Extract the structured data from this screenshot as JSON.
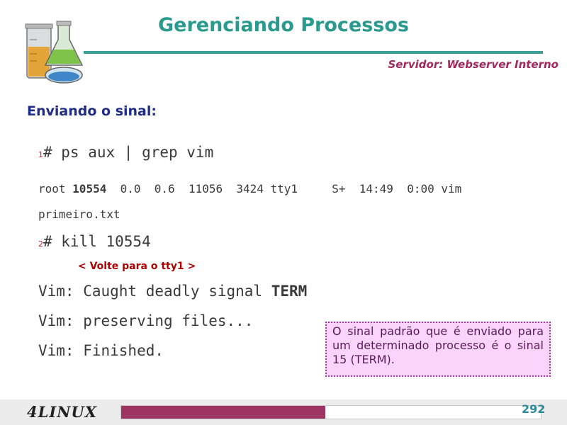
{
  "header": {
    "title": "Gerenciando Processos",
    "subtitle": "Servidor: Webserver Interno"
  },
  "section_title": "Enviando o sinal:",
  "steps": [
    {
      "number": "1",
      "command": "# ps aux | grep vim"
    },
    {
      "number": "2",
      "command": "# kill 10554"
    }
  ],
  "ps_output": {
    "prefix": "root ",
    "pid": "10554",
    "rest": "  0.0  0.6  11056  3424 tty1     S+  14:49  0:00 vim",
    "line2": "primeiro.txt"
  },
  "note": "< Volte para o tty1 >",
  "vim_output": {
    "line1_prefix": "Vim: Caught deadly signal ",
    "line1_signal": "TERM",
    "line2": "Vim: preserving files...",
    "line3": "Vim: Finished."
  },
  "callout": "O sinal padrão que é enviado para um determinado processo é o sinal 15 (TERM).",
  "footer": {
    "brand": "4LINUX",
    "page_number": "292",
    "progress_fraction": 0.486
  },
  "icons": {
    "logo": "lab-flasks-icon"
  }
}
